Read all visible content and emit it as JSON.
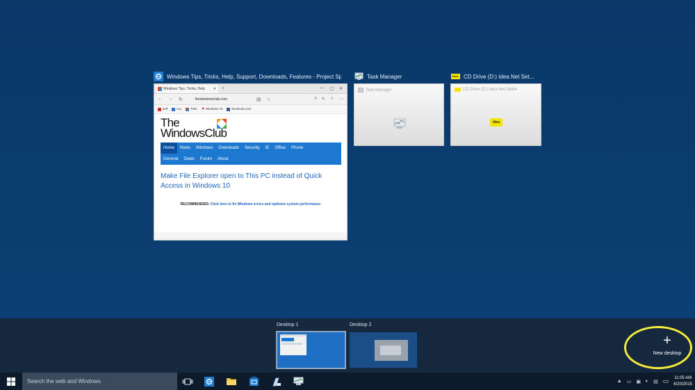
{
  "windows": [
    {
      "title": "Windows Tips, Tricks, Help, Support, Downloads, Features - Project Sp...",
      "icon": "edge-icon",
      "browser": {
        "tab_title": "Windows Tips, Tricks, Help",
        "tab_close": "✕",
        "new_tab": "+",
        "address": "thewindowsclub.com",
        "favorites": [
          "avft",
          "xxx",
          "TWC",
          "Windows 10",
          "facebook.com"
        ],
        "logo_line1": "The",
        "logo_line2": "WindowsClub",
        "nav_row1": [
          "Home",
          "News",
          "Windows",
          "Downloads",
          "Security",
          "IE",
          "Office",
          "Phone"
        ],
        "nav_row2": [
          "General",
          "Deals",
          "Forum",
          "About"
        ],
        "article_title": "Make File Explorer open to This PC instead of Quick Access in Windows 10",
        "recommended_label": "RECOMMENDED:",
        "recommended_link": "Click here to fix Windows errors and optimize system performance"
      }
    },
    {
      "title": "Task Manager",
      "icon": "task-manager-icon",
      "thumb_title": "Task Manager"
    },
    {
      "title": "CD Drive (D:) Idea Net Set...",
      "icon": "idea-netsetter-icon",
      "thumb_title": "CD Drive (D:) Idea Net Setter",
      "badge": "idea"
    }
  ],
  "desktops": [
    {
      "label": "Desktop 1",
      "selected": true
    },
    {
      "label": "Desktop 2",
      "selected": false
    }
  ],
  "new_desktop": {
    "symbol": "+",
    "label": "New desktop"
  },
  "taskbar": {
    "search_placeholder": "Search the web and Windows",
    "clock_time": "11:05 AM",
    "clock_date": "6/20/2015"
  },
  "colors": {
    "desktop_bg": "#0b3c6e",
    "taskbar_bg": "#0d1a2a",
    "accent": "#1d79d0",
    "highlight": "#f4eb3a"
  }
}
